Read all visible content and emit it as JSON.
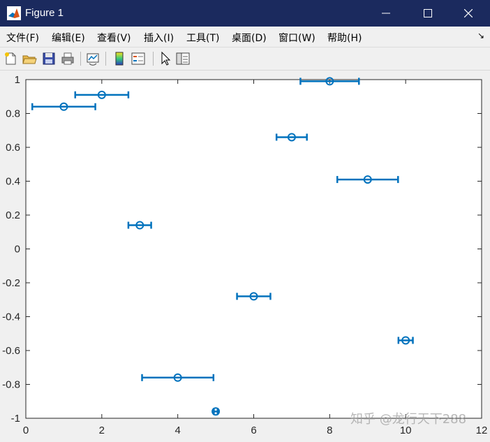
{
  "window": {
    "title": "Figure 1"
  },
  "menu": {
    "items": [
      "文件(F)",
      "编辑(E)",
      "查看(V)",
      "插入(I)",
      "工具(T)",
      "桌面(D)",
      "窗口(W)",
      "帮助(H)"
    ]
  },
  "toolbar": {
    "icons": [
      "new-figure-icon",
      "open-file-icon",
      "save-icon",
      "print-icon",
      "link-plot-icon",
      "insert-colorbar-icon",
      "insert-legend-icon",
      "edit-plot-pointer-icon",
      "property-inspector-icon"
    ]
  },
  "colors": {
    "series": "#0072bd",
    "titlebar": "#1b2a5e"
  },
  "chart_data": {
    "type": "scatter",
    "subtype": "horizontal errorbar",
    "x": [
      1,
      2,
      3,
      4,
      5,
      6,
      7,
      8,
      9,
      10
    ],
    "y": [
      0.84,
      0.91,
      0.14,
      -0.76,
      -0.96,
      -0.28,
      0.66,
      0.99,
      0.41,
      -0.54
    ],
    "xneg": [
      0.83,
      0.7,
      0.3,
      0.94,
      0.05,
      0.44,
      0.4,
      0.77,
      0.8,
      0.19
    ],
    "xpos": [
      0.83,
      0.7,
      0.3,
      0.94,
      0.05,
      0.44,
      0.4,
      0.77,
      0.8,
      0.19
    ],
    "marker": "circle",
    "xlim": [
      0,
      12
    ],
    "ylim": [
      -1,
      1
    ],
    "xticks": [
      "0",
      "2",
      "4",
      "6",
      "8",
      "10",
      "12"
    ],
    "yticks": [
      "-1",
      "-0.8",
      "-0.6",
      "-0.4",
      "-0.2",
      "0",
      "0.2",
      "0.4",
      "0.6",
      "0.8",
      "1"
    ],
    "grid": false,
    "title": "",
    "xlabel": "",
    "ylabel": ""
  },
  "watermark": "知乎 @龙行天下288"
}
